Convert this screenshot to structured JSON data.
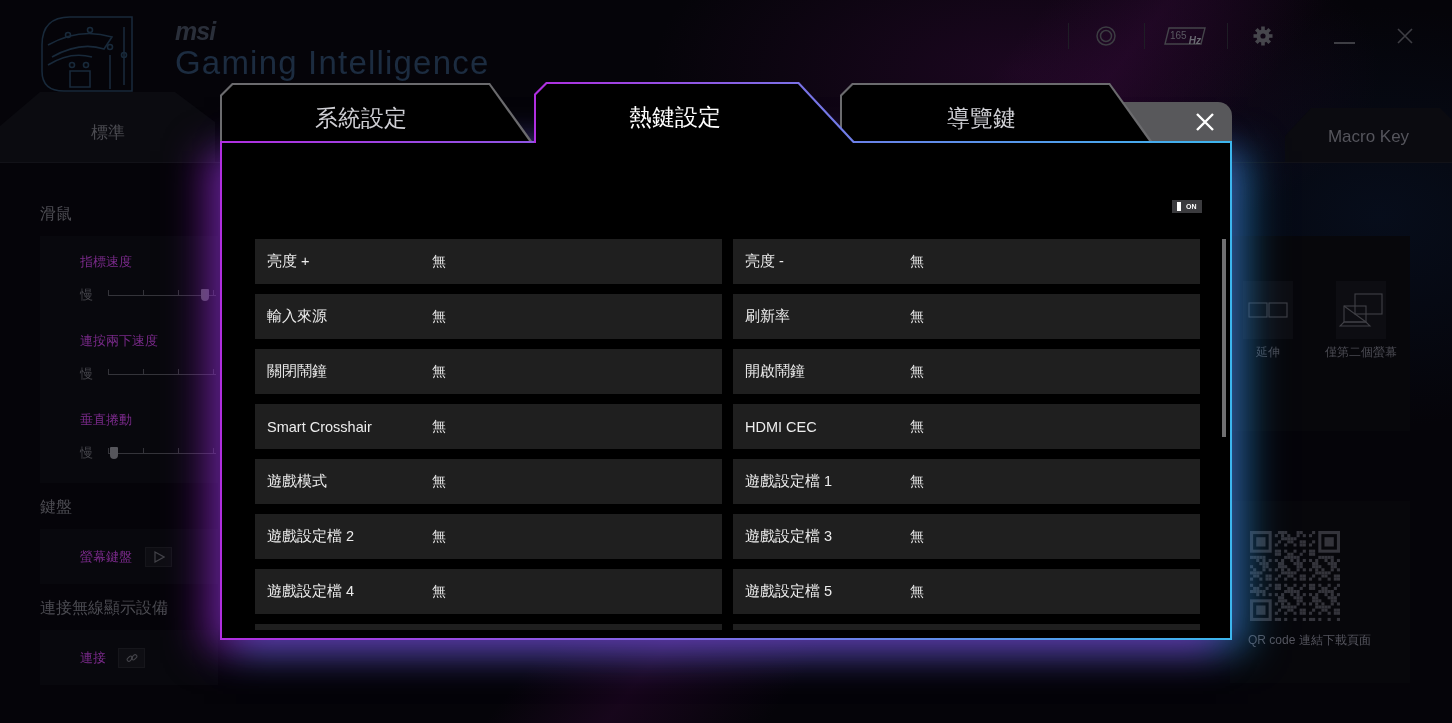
{
  "header": {
    "brand": "msi",
    "title": "Gaming Intelligence",
    "refresh_rate": "165",
    "refresh_unit": "Hz"
  },
  "mode_tabs": [
    {
      "label": "標準",
      "selected": false
    },
    {
      "label": "Macro Key",
      "selected": false
    }
  ],
  "left_panel": {
    "sections": [
      {
        "heading": "滑鼠",
        "controls": [
          {
            "kind": "slider",
            "label": "指標速度",
            "min_label": "慢",
            "level": 0.9
          },
          {
            "kind": "slider",
            "label": "連按兩下速度",
            "min_label": "慢"
          },
          {
            "kind": "slider",
            "label": "垂直捲動",
            "min_label": "慢",
            "level": 0.06
          }
        ]
      },
      {
        "heading": "鍵盤",
        "controls": [
          {
            "kind": "play",
            "label": "螢幕鍵盤"
          }
        ]
      },
      {
        "heading": "連接無線顯示設備",
        "controls": [
          {
            "kind": "link",
            "label": "連接"
          }
        ]
      }
    ]
  },
  "right_panel": {
    "display_modes": [
      {
        "kind": "extend",
        "label": "延伸"
      },
      {
        "kind": "second_screen",
        "label": "僅第二個螢幕"
      }
    ],
    "qr_caption": "QR code 連結下載頁面"
  },
  "dialog": {
    "tabs": [
      {
        "label": "系統設定",
        "selected": false
      },
      {
        "label": "熱鍵設定",
        "selected": true
      },
      {
        "label": "導覽鍵",
        "selected": false
      }
    ],
    "toggle": {
      "label": "ON",
      "on": true
    },
    "hotkeys": [
      {
        "kind": "hotkey",
        "name": "亮度 +",
        "value": "無"
      },
      {
        "kind": "hotkey",
        "name": "亮度 -",
        "value": "無"
      },
      {
        "kind": "hotkey",
        "name": "輸入來源",
        "value": "無"
      },
      {
        "kind": "hotkey",
        "name": "刷新率",
        "value": "無"
      },
      {
        "kind": "hotkey",
        "name": "關閉鬧鐘",
        "value": "無"
      },
      {
        "kind": "hotkey",
        "name": "開啟鬧鐘",
        "value": "無"
      },
      {
        "kind": "hotkey",
        "name": "Smart Crosshair",
        "value": "無"
      },
      {
        "kind": "hotkey",
        "name": "HDMI CEC",
        "value": "無"
      },
      {
        "kind": "hotkey",
        "name": "遊戲模式",
        "value": "無"
      },
      {
        "kind": "hotkey",
        "name": "遊戲設定檔 1",
        "value": "無"
      },
      {
        "kind": "hotkey",
        "name": "遊戲設定檔 2",
        "value": "無"
      },
      {
        "kind": "hotkey",
        "name": "遊戲設定檔 3",
        "value": "無"
      },
      {
        "kind": "hotkey",
        "name": "遊戲設定檔 4",
        "value": "無"
      },
      {
        "kind": "hotkey",
        "name": "遊戲設定檔 5",
        "value": "無"
      },
      {
        "kind": "clipped"
      },
      {
        "kind": "clipped"
      }
    ]
  }
}
